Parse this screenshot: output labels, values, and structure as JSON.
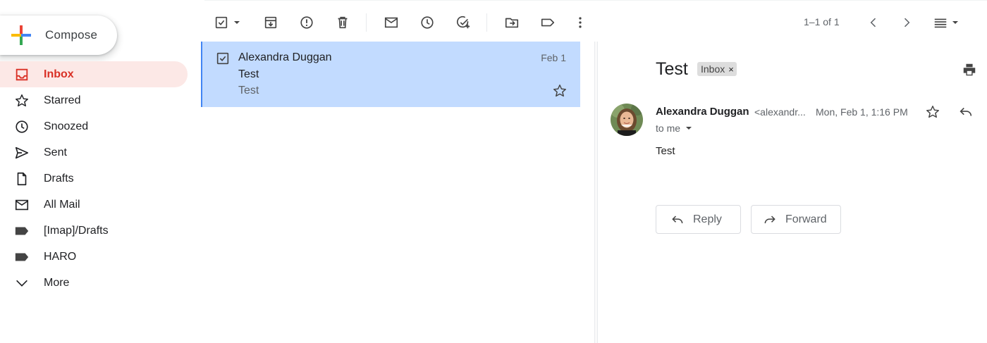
{
  "compose": {
    "label": "Compose"
  },
  "nav": [
    {
      "label": "Inbox",
      "icon": "inbox-icon",
      "active": true
    },
    {
      "label": "Starred",
      "icon": "star-icon"
    },
    {
      "label": "Snoozed",
      "icon": "clock-icon"
    },
    {
      "label": "Sent",
      "icon": "send-icon"
    },
    {
      "label": "Drafts",
      "icon": "draft-icon"
    },
    {
      "label": "All Mail",
      "icon": "mail-icon"
    },
    {
      "label": "[Imap]/Drafts",
      "icon": "label-icon"
    },
    {
      "label": "HARO",
      "icon": "label-icon"
    },
    {
      "label": "More",
      "icon": "chevron-down-icon"
    }
  ],
  "toolbar": {
    "pager": "1–1 of 1"
  },
  "messages": [
    {
      "sender": "Alexandra Duggan",
      "subject": "Test",
      "snippet": "Test",
      "date": "Feb 1"
    }
  ],
  "reading": {
    "subject": "Test",
    "label": "Inbox",
    "label_close": "×",
    "sender_name": "Alexandra Duggan",
    "sender_email": "<alexandr...",
    "date": "Mon, Feb 1, 1:16 PM",
    "to": "to me",
    "body": "Test",
    "reply_label": "Reply",
    "forward_label": "Forward"
  },
  "colors": {
    "accent_red": "#d93025",
    "selected_row": "#c2dbff",
    "active_nav": "#fce8e6"
  }
}
